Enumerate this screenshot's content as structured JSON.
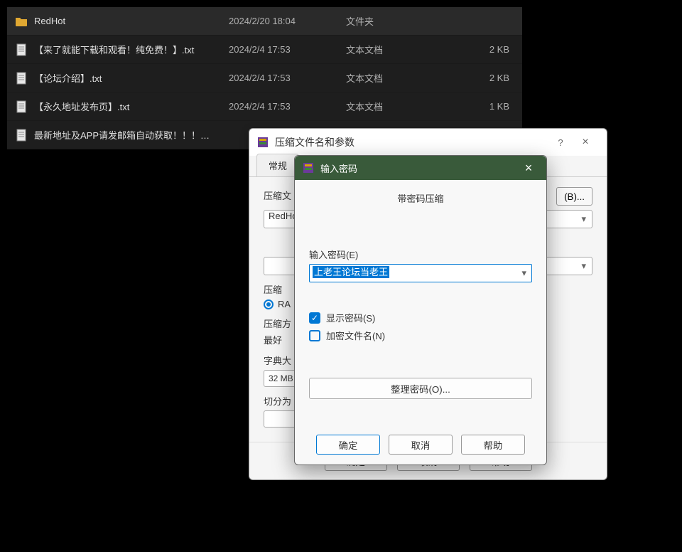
{
  "file_list": {
    "rows": [
      {
        "name": "RedHot",
        "date": "2024/2/20 18:04",
        "type": "文件夹",
        "size": "",
        "kind": "folder"
      },
      {
        "name": "【来了就能下载和观看！纯免费！】.txt",
        "date": "2024/2/4 17:53",
        "type": "文本文档",
        "size": "2 KB",
        "kind": "txt"
      },
      {
        "name": "【论坛介绍】.txt",
        "date": "2024/2/4 17:53",
        "type": "文本文档",
        "size": "2 KB",
        "kind": "txt"
      },
      {
        "name": "【永久地址发布页】.txt",
        "date": "2024/2/4 17:53",
        "type": "文本文档",
        "size": "1 KB",
        "kind": "txt"
      },
      {
        "name": "最新地址及APP请发邮箱自动获取！！！…",
        "date": "",
        "type": "",
        "size": "",
        "kind": "txt"
      }
    ]
  },
  "archive_dialog": {
    "title": "压缩文件名和参数",
    "help_glyph": "?",
    "close_glyph": "×",
    "tab_general": "常规",
    "archive_label": "压缩文",
    "browse_btn": "(B)...",
    "archive_name": "RedHo",
    "format_label": "压缩",
    "format_value": "RA",
    "method_label1": "压缩方",
    "method_label2": "最好",
    "dict_label": "字典大",
    "dict_value": "32 MB",
    "split_label": "切分为",
    "ok": "确定",
    "cancel": "取消",
    "help": "帮助"
  },
  "password_dialog": {
    "title": "输入密码",
    "close_glyph": "×",
    "subtitle": "带密码压缩",
    "enter_label": "输入密码(E)",
    "password_value": "上老王论坛当老王",
    "show_password": "显示密码(S)",
    "encrypt_filenames": "加密文件名(N)",
    "manage": "整理密码(O)...",
    "ok": "确定",
    "cancel": "取消",
    "help": "帮助",
    "show_checked": true,
    "encrypt_checked": false
  }
}
